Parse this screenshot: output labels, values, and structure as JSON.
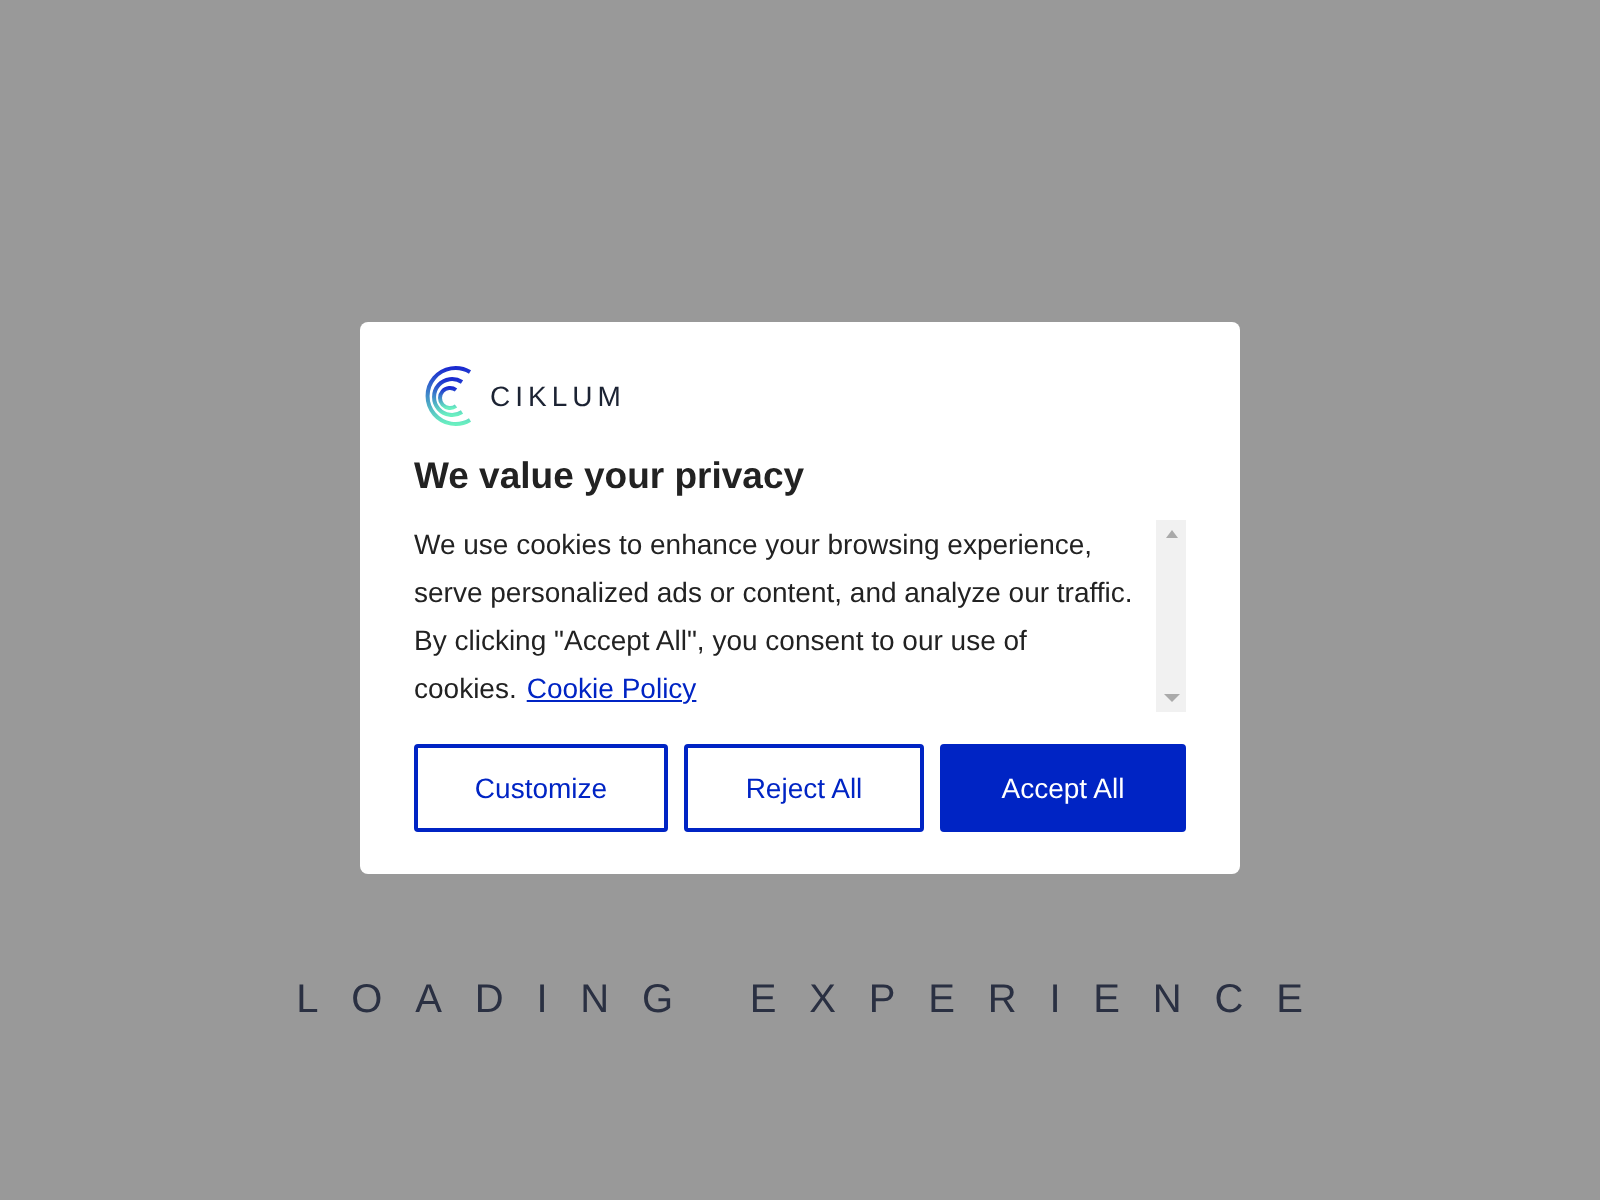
{
  "dialog": {
    "brand": "CIKLUM",
    "title": "We value your privacy",
    "body": "We use cookies to enhance your browsing experience, serve personalized ads or content, and analyze our traffic. By clicking \"Accept All\", you consent to our use of cookies.",
    "link": "Cookie Policy",
    "buttons": [
      {
        "label": "Customize",
        "kind": "outline"
      },
      {
        "label": "Reject All",
        "kind": "outline"
      },
      {
        "label": "Accept All",
        "kind": "filled"
      }
    ]
  },
  "loading": "LOADING EXPERIENCE"
}
